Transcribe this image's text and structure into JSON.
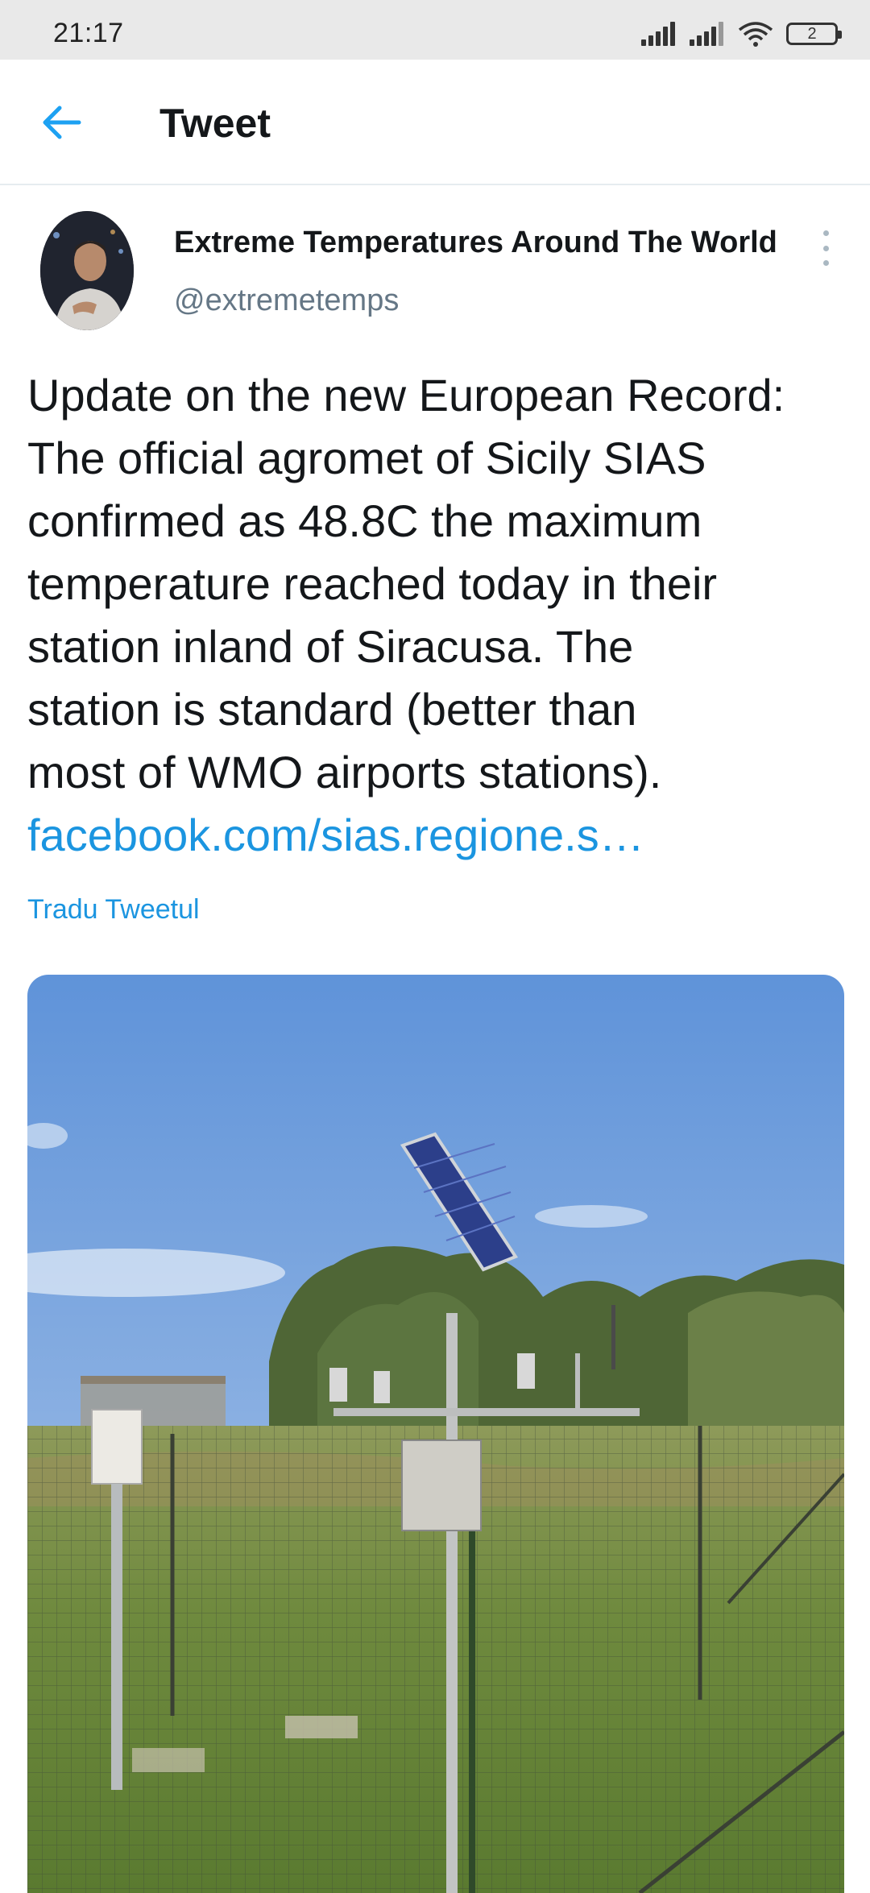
{
  "status_bar": {
    "time": "21:17",
    "battery": "2",
    "icons": [
      "signal-icon",
      "signal-icon",
      "wifi-icon",
      "battery-icon"
    ]
  },
  "header": {
    "title": "Tweet",
    "back_icon": "arrow-left-icon"
  },
  "tweet": {
    "author_name": "Extreme Temperatures Around The World",
    "author_handle": "@extremetemps",
    "text_lines": [
      "Update on the new European Record:",
      "The official agromet of Sicily SIAS",
      "confirmed as 48.8C the maximum",
      "temperature reached today in their",
      "station inland of Siracusa. The",
      "station is standard (better than",
      "most of WMO airports stations)."
    ],
    "link": "facebook.com/sias.regione.s…",
    "translate_label": "Tradu Tweetul"
  },
  "colors": {
    "accent": "#1b95e0",
    "secondary_text": "#657786",
    "status_bar_bg": "#e9e9e9"
  }
}
